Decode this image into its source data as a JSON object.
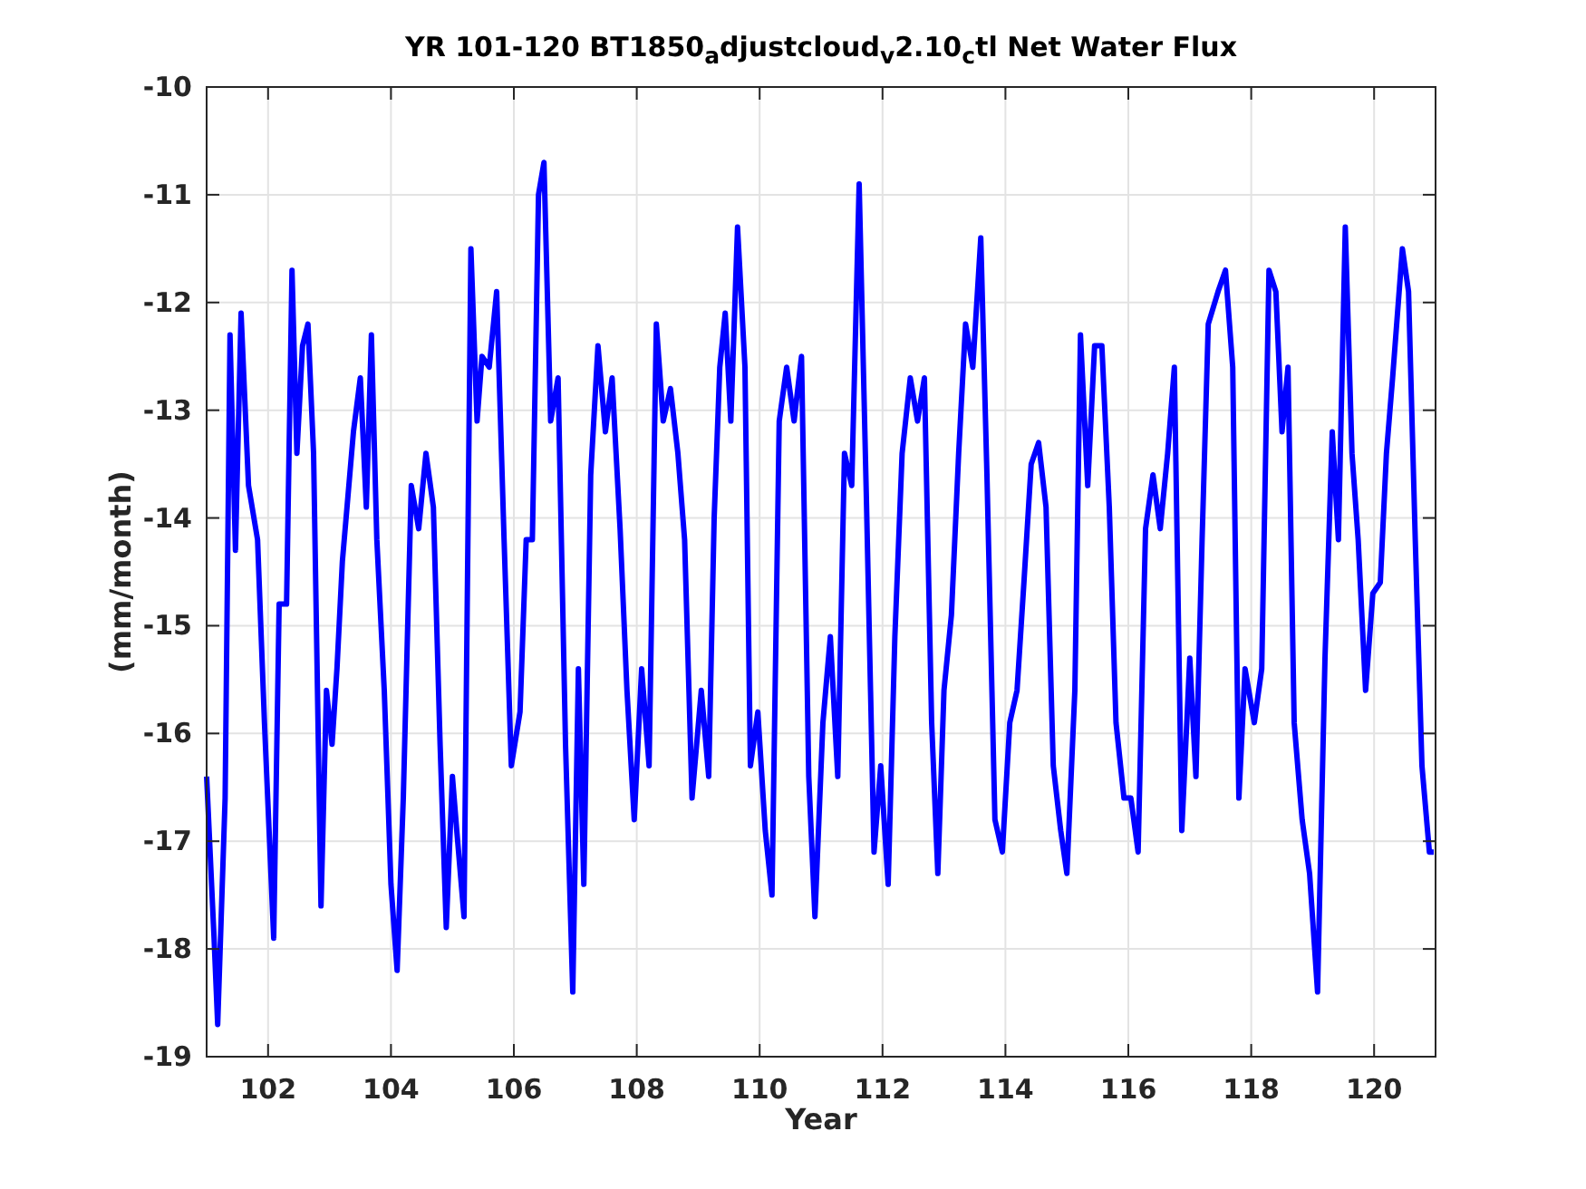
{
  "figure": {
    "chart_data": {
      "type": "line",
      "title": "YR 101-120 BT1850$_{a}$djustcloud$_{v}$2.10$_{c}$tl Net Water Flux",
      "xlabel": "Year",
      "ylabel": "(mm/month)",
      "x": [
        101.0,
        101.12,
        101.18,
        101.3,
        101.38,
        101.47,
        101.56,
        101.68,
        101.83,
        101.94,
        102.09,
        102.18,
        102.3,
        102.39,
        102.47,
        102.56,
        102.65,
        102.74,
        102.86,
        102.95,
        103.04,
        103.12,
        103.21,
        103.39,
        103.5,
        103.6,
        103.68,
        103.77,
        103.89,
        104.0,
        104.1,
        104.2,
        104.33,
        104.45,
        104.57,
        104.69,
        104.8,
        104.9,
        105.0,
        105.07,
        105.19,
        105.3,
        105.4,
        105.48,
        105.6,
        105.72,
        105.84,
        105.96,
        106.1,
        106.2,
        106.3,
        106.4,
        106.49,
        106.6,
        106.72,
        106.84,
        106.96,
        107.05,
        107.14,
        107.25,
        107.37,
        107.49,
        107.6,
        107.73,
        107.84,
        107.96,
        108.08,
        108.2,
        108.32,
        108.43,
        108.55,
        108.67,
        108.78,
        108.9,
        109.05,
        109.17,
        109.26,
        109.35,
        109.44,
        109.53,
        109.64,
        109.76,
        109.85,
        109.97,
        110.09,
        110.2,
        110.32,
        110.44,
        110.56,
        110.68,
        110.8,
        110.9,
        111.03,
        111.15,
        111.27,
        111.38,
        111.5,
        111.62,
        111.74,
        111.86,
        111.97,
        112.09,
        112.2,
        112.32,
        112.45,
        112.57,
        112.68,
        112.8,
        112.9,
        113.0,
        113.12,
        113.24,
        113.35,
        113.47,
        113.6,
        113.7,
        113.83,
        113.95,
        114.07,
        114.19,
        114.3,
        114.42,
        114.54,
        114.66,
        114.78,
        114.9,
        115.0,
        115.13,
        115.22,
        115.34,
        115.45,
        115.57,
        115.69,
        115.8,
        115.93,
        116.04,
        116.16,
        116.28,
        116.4,
        116.52,
        116.64,
        116.75,
        116.87,
        117.0,
        117.1,
        117.2,
        117.3,
        117.46,
        117.58,
        117.7,
        117.8,
        117.9,
        118.05,
        118.17,
        118.29,
        118.4,
        118.5,
        118.6,
        118.7,
        118.83,
        118.95,
        119.08,
        119.2,
        119.32,
        119.42,
        119.53,
        119.64,
        119.74,
        119.86,
        119.98,
        120.1,
        120.2,
        120.3,
        120.46,
        120.56,
        120.67,
        120.78,
        120.9,
        120.97
      ],
      "series": [
        {
          "color": "#0000ff",
          "values": [
            -16.4,
            -17.9,
            -18.7,
            -16.6,
            -12.3,
            -14.3,
            -12.1,
            -13.7,
            -14.2,
            -15.9,
            -17.9,
            -14.8,
            -14.8,
            -11.7,
            -13.4,
            -12.4,
            -12.2,
            -13.4,
            -17.6,
            -15.6,
            -16.1,
            -15.4,
            -14.4,
            -13.2,
            -12.7,
            -13.9,
            -12.3,
            -14.2,
            -15.6,
            -17.4,
            -18.2,
            -16.6,
            -13.7,
            -14.1,
            -13.4,
            -13.9,
            -16.1,
            -17.8,
            -16.4,
            -16.9,
            -17.7,
            -11.5,
            -13.1,
            -12.5,
            -12.6,
            -11.9,
            -14.2,
            -16.3,
            -15.8,
            -14.2,
            -14.2,
            -11.0,
            -10.7,
            -13.1,
            -12.7,
            -16.1,
            -18.4,
            -15.4,
            -17.4,
            -13.6,
            -12.4,
            -13.2,
            -12.7,
            -14.1,
            -15.6,
            -16.8,
            -15.4,
            -16.3,
            -12.2,
            -13.1,
            -12.8,
            -13.4,
            -14.2,
            -16.6,
            -15.6,
            -16.4,
            -14.0,
            -12.6,
            -12.1,
            -13.1,
            -11.3,
            -12.6,
            -16.3,
            -15.8,
            -16.9,
            -17.5,
            -13.1,
            -12.6,
            -13.1,
            -12.5,
            -16.4,
            -17.7,
            -15.9,
            -15.1,
            -16.4,
            -13.4,
            -13.7,
            -10.9,
            -13.9,
            -17.1,
            -16.3,
            -17.4,
            -15.1,
            -13.4,
            -12.7,
            -13.1,
            -12.7,
            -15.9,
            -17.3,
            -15.6,
            -14.9,
            -13.4,
            -12.2,
            -12.6,
            -11.4,
            -13.6,
            -16.8,
            -17.1,
            -15.9,
            -15.6,
            -14.6,
            -13.5,
            -13.3,
            -13.9,
            -16.3,
            -16.9,
            -17.3,
            -15.6,
            -12.3,
            -13.7,
            -12.4,
            -12.4,
            -13.9,
            -15.9,
            -16.6,
            -16.6,
            -17.1,
            -14.1,
            -13.6,
            -14.1,
            -13.4,
            -12.6,
            -16.9,
            -15.3,
            -16.4,
            -14.2,
            -12.2,
            -11.9,
            -11.7,
            -12.6,
            -16.6,
            -15.4,
            -15.9,
            -15.4,
            -11.7,
            -11.9,
            -13.2,
            -12.6,
            -15.9,
            -16.8,
            -17.3,
            -18.4,
            -15.3,
            -13.2,
            -14.2,
            -11.3,
            -13.4,
            -14.2,
            -15.6,
            -14.7,
            -14.6,
            -13.4,
            -12.7,
            -11.5,
            -11.9,
            -14.2,
            -16.3,
            -17.1,
            -17.1
          ]
        }
      ],
      "grid": true,
      "xlim": [
        101,
        121
      ],
      "ylim": [
        -19,
        -10
      ],
      "xticks": [
        102,
        104,
        106,
        108,
        110,
        112,
        114,
        116,
        118,
        120
      ],
      "yticks": [
        -19,
        -18,
        -17,
        -16,
        -15,
        -14,
        -13,
        -12,
        -11,
        -10
      ]
    }
  }
}
